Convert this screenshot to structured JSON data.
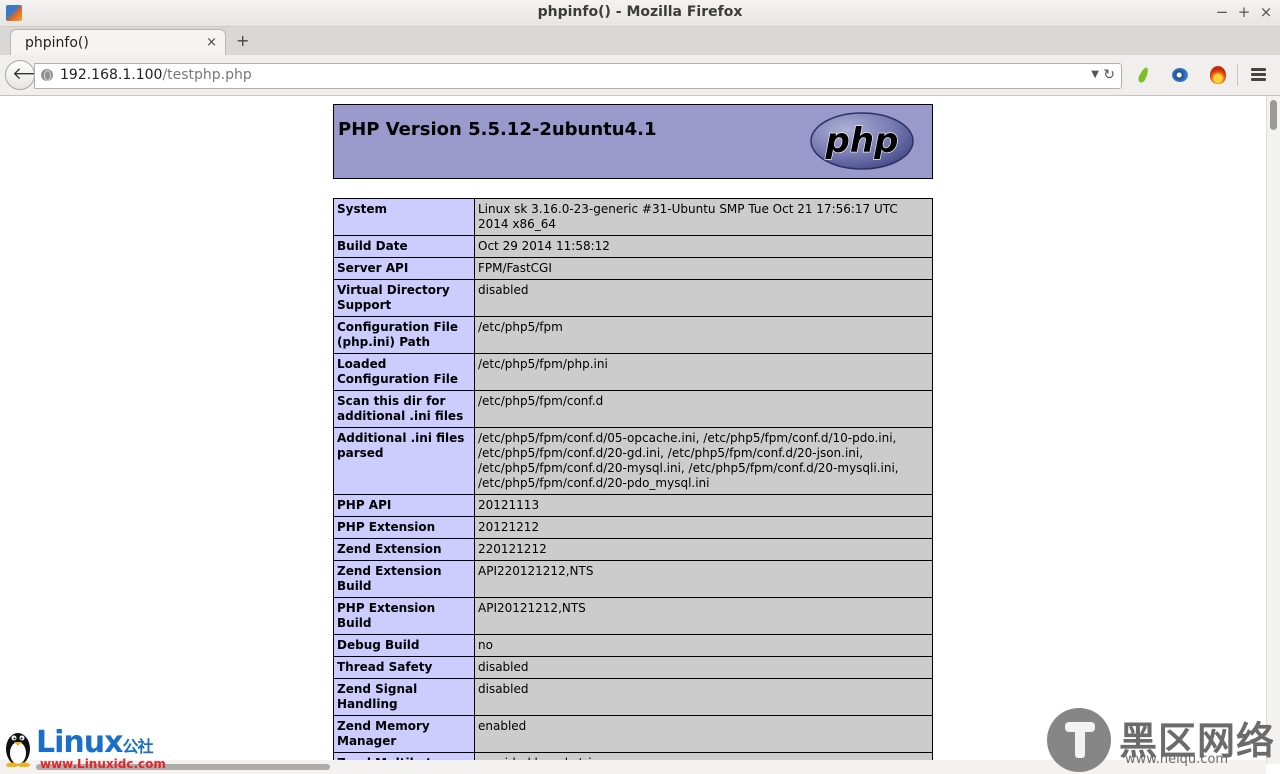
{
  "window": {
    "title": "phpinfo() - Mozilla Firefox",
    "minimize": "−",
    "maximize": "+",
    "close": "×"
  },
  "tabs": [
    {
      "label": "phpinfo()",
      "close": "×"
    }
  ],
  "new_tab": "+",
  "nav": {
    "back": "🡐",
    "url_host": "192.168.1.100",
    "url_path": "/testphp.php",
    "dropdown": "▼",
    "reload": "↻"
  },
  "icons": [
    "leaf-icon",
    "eye-icon",
    "fire-icon",
    "menu-icon"
  ],
  "page": {
    "title": "PHP Version 5.5.12-2ubuntu4.1",
    "logo_text": "php",
    "rows": [
      {
        "key": "System",
        "value": "Linux sk 3.16.0-23-generic #31-Ubuntu SMP Tue Oct 21 17:56:17 UTC 2014 x86_64"
      },
      {
        "key": "Build Date",
        "value": "Oct 29 2014 11:58:12"
      },
      {
        "key": "Server API",
        "value": "FPM/FastCGI"
      },
      {
        "key": "Virtual Directory Support",
        "value": "disabled"
      },
      {
        "key": "Configuration File (php.ini) Path",
        "value": "/etc/php5/fpm"
      },
      {
        "key": "Loaded Configuration File",
        "value": "/etc/php5/fpm/php.ini"
      },
      {
        "key": "Scan this dir for additional .ini files",
        "value": "/etc/php5/fpm/conf.d"
      },
      {
        "key": "Additional .ini files parsed",
        "value": "/etc/php5/fpm/conf.d/05-opcache.ini, /etc/php5/fpm/conf.d/10-pdo.ini, /etc/php5/fpm/conf.d/20-gd.ini, /etc/php5/fpm/conf.d/20-json.ini, /etc/php5/fpm/conf.d/20-mysql.ini, /etc/php5/fpm/conf.d/20-mysqli.ini, /etc/php5/fpm/conf.d/20-pdo_mysql.ini"
      },
      {
        "key": "PHP API",
        "value": "20121113"
      },
      {
        "key": "PHP Extension",
        "value": "20121212"
      },
      {
        "key": "Zend Extension",
        "value": "220121212"
      },
      {
        "key": "Zend Extension Build",
        "value": "API220121212,NTS"
      },
      {
        "key": "PHP Extension Build",
        "value": "API20121212,NTS"
      },
      {
        "key": "Debug Build",
        "value": "no"
      },
      {
        "key": "Thread Safety",
        "value": "disabled"
      },
      {
        "key": "Zend Signal Handling",
        "value": "disabled"
      },
      {
        "key": "Zend Memory Manager",
        "value": "enabled"
      },
      {
        "key": "Zend Multibyte Support",
        "value": "provided by mbstring"
      }
    ]
  },
  "watermarks": {
    "left_brand": "Linux",
    "left_brand_cn": "公社",
    "left_url": "www.Linuxidc.com",
    "right_brand": "黑区网络",
    "right_url": "www.heiqu.com"
  },
  "colors": {
    "header_bg": "#9999cc",
    "key_bg": "#ccccff",
    "value_bg": "#cccccc",
    "linux_blue": "#1a6fc6",
    "linux_red": "#e0262b"
  }
}
